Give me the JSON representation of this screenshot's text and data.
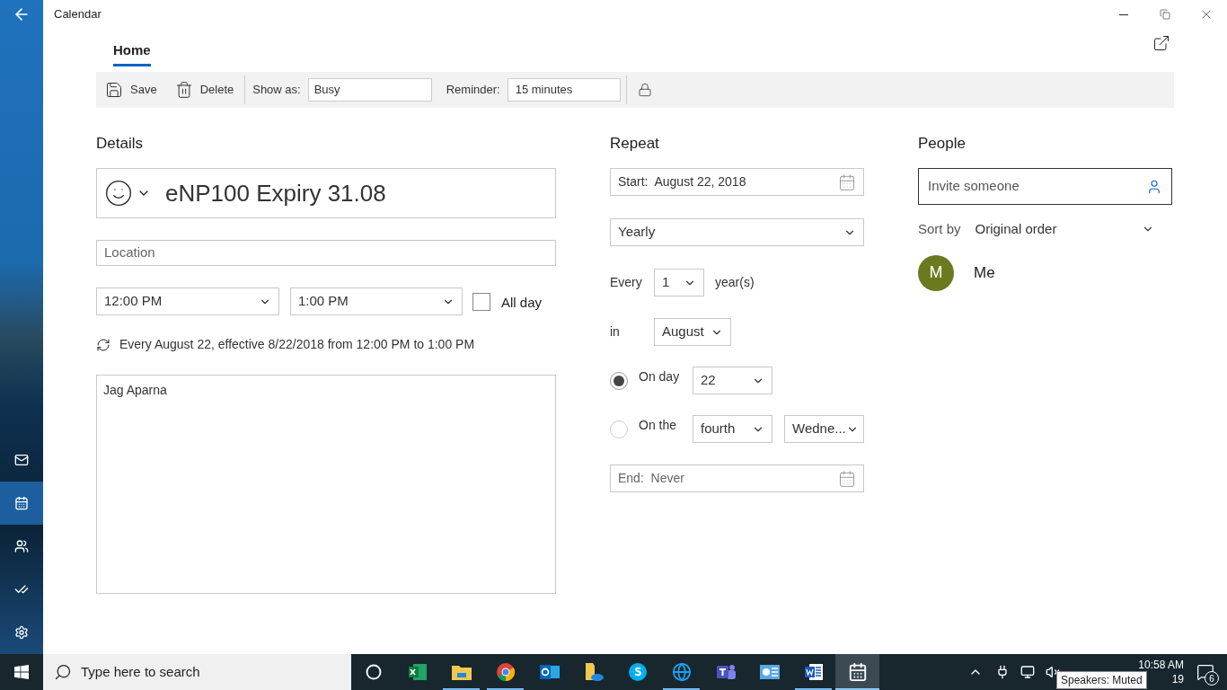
{
  "window": {
    "title": "Calendar"
  },
  "sidebar": {
    "items": [
      {
        "kind": "mail",
        "selected": false
      },
      {
        "kind": "calendar",
        "selected": true
      },
      {
        "kind": "people",
        "selected": false
      },
      {
        "kind": "todo",
        "selected": false
      },
      {
        "kind": "settings",
        "selected": false
      }
    ]
  },
  "tabs": [
    {
      "label": "Home",
      "selected": true
    }
  ],
  "toolbar": {
    "save": "Save",
    "delete": "Delete",
    "show_as_label": "Show as:",
    "show_as": "Busy",
    "reminder_label": "Reminder:",
    "reminder": "15 minutes"
  },
  "details": {
    "heading": "Details",
    "title": "eNP100 Expiry 31.08",
    "location_placeholder": "Location",
    "start_time": "12:00 PM",
    "end_time": "1:00 PM",
    "all_day": {
      "label": "All day",
      "checked": false
    },
    "summary": "Every August 22, effective 8/22/2018 from 12:00 PM to 1:00 PM",
    "notes": "Jag Aparna"
  },
  "repeat": {
    "heading": "Repeat",
    "start_label": "Start:",
    "start": "August 22, 2018",
    "pattern": "Yearly",
    "every_label": "Every",
    "every": "1",
    "unit": "year(s)",
    "in_label": "in",
    "month": "August",
    "options": [
      {
        "label": "On day",
        "selected": true,
        "selects": [
          "22"
        ]
      },
      {
        "label": "On the",
        "selected": false,
        "selects": [
          "fourth",
          "Wedne..."
        ]
      }
    ],
    "end_label": "End:",
    "end": "Never"
  },
  "people": {
    "heading": "People",
    "invite_placeholder": "Invite someone",
    "sort_label": "Sort by",
    "sort": "Original order",
    "attendees": [
      {
        "initial": "M",
        "name": "Me",
        "color": "#6b7a1f"
      }
    ]
  },
  "taskbar": {
    "search_placeholder": "Type here to search",
    "apps": [
      {
        "kind": "cortana",
        "running": false,
        "selected": false
      },
      {
        "kind": "excel",
        "running": false,
        "selected": false
      },
      {
        "kind": "folder",
        "running": true,
        "selected": false
      },
      {
        "kind": "chrome",
        "running": true,
        "selected": false
      },
      {
        "kind": "outlook",
        "running": false,
        "selected": false
      },
      {
        "kind": "cloud-folder",
        "running": false,
        "selected": false
      },
      {
        "kind": "skype",
        "running": false,
        "selected": false
      },
      {
        "kind": "ie",
        "running": true,
        "selected": false
      },
      {
        "kind": "teams",
        "running": false,
        "selected": false
      },
      {
        "kind": "chart",
        "running": false,
        "selected": false
      },
      {
        "kind": "word",
        "running": true,
        "selected": false
      },
      {
        "kind": "calendar",
        "running": true,
        "selected": true
      }
    ],
    "time": "10:58 AM",
    "date": "19",
    "tooltip": "Speakers: Muted",
    "notifications": "6"
  }
}
